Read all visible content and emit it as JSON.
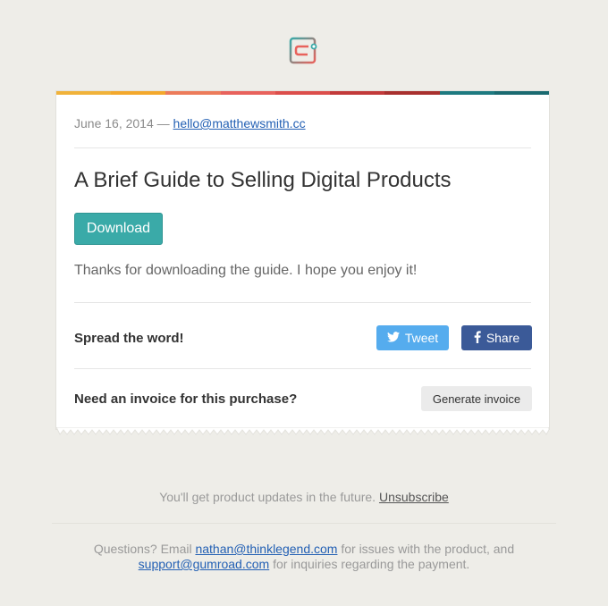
{
  "header": {
    "logo_icon": "gumroad-logo-icon"
  },
  "stripe_colors": [
    "#f0b23a",
    "#f3a82c",
    "#ec7b5a",
    "#e8625c",
    "#dc4e4b",
    "#c23a3a",
    "#a8302e",
    "#1e7a80",
    "#1a6a70"
  ],
  "email": {
    "date": "June 16, 2014",
    "separator": " — ",
    "sender_email": "hello@matthewsmith.cc",
    "product_title": "A Brief Guide to Selling Digital Products",
    "download_label": "Download",
    "thanks_text": "Thanks for downloading the guide. I hope you enjoy it!",
    "spread_label": "Spread the word!",
    "tweet_label": "Tweet",
    "share_label": "Share",
    "invoice_question": "Need an invoice for this purchase?",
    "invoice_button": "Generate invoice"
  },
  "footer": {
    "updates_text": "You'll get product updates in the future.",
    "unsubscribe_label": "Unsubscribe",
    "questions_prefix": "Questions? Email",
    "product_email": "nathan@thinklegend.com",
    "product_suffix": "for issues with the product, and",
    "support_email": "support@gumroad.com",
    "support_suffix": "for inquiries regarding the payment."
  }
}
